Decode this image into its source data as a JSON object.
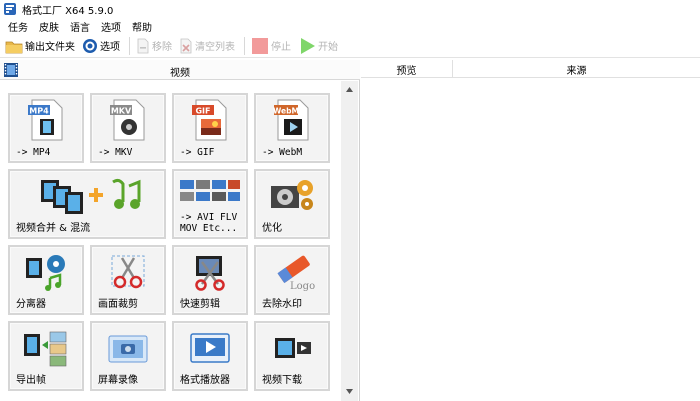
{
  "window": {
    "title": "格式工厂 X64 5.9.0"
  },
  "menu": {
    "items": [
      "任务",
      "皮肤",
      "语言",
      "选项",
      "帮助"
    ]
  },
  "toolbar": {
    "output_folder": "输出文件夹",
    "options": "选项",
    "remove": "移除",
    "clear_list": "清空列表",
    "stop": "停止",
    "start": "开始"
  },
  "category": {
    "title": "视频"
  },
  "tiles": [
    {
      "id": "mp4",
      "label": "-> MP4",
      "badge": "MP4"
    },
    {
      "id": "mkv",
      "label": "-> MKV",
      "badge": "MKV"
    },
    {
      "id": "gif",
      "label": "-> GIF",
      "badge": "GIF"
    },
    {
      "id": "webm",
      "label": "-> WebM",
      "badge": "WebM"
    },
    {
      "id": "merge",
      "label": "视频合并 & 混流"
    },
    {
      "id": "avi",
      "label": "-> AVI FLV\nMOV Etc..."
    },
    {
      "id": "optimize",
      "label": "优化"
    },
    {
      "id": "splitter",
      "label": "分离器"
    },
    {
      "id": "crop",
      "label": "画面裁剪"
    },
    {
      "id": "quickcut",
      "label": "快速剪辑"
    },
    {
      "id": "watermark",
      "label": "去除水印",
      "logo_text": "Logo"
    },
    {
      "id": "frames",
      "label": "导出帧"
    },
    {
      "id": "record",
      "label": "屏幕录像"
    },
    {
      "id": "player",
      "label": "格式播放器"
    },
    {
      "id": "download",
      "label": "视频下载"
    }
  ],
  "list": {
    "col_preview": "预览",
    "col_source": "来源"
  },
  "colors": {
    "mp4_badge": "#3b79c9",
    "mkv_badge": "#8a8a8a",
    "gif_badge": "#d84a2a",
    "webm_badge": "#d0662a",
    "start": "#5dc64a",
    "stop": "#f08c8c"
  },
  "icons": {
    "app": "format-factory-icon",
    "output_folder": "folder-icon",
    "options": "gear-icon",
    "remove": "remove-document-icon",
    "clear": "clear-list-icon",
    "stop": "stop-icon",
    "start": "play-icon"
  }
}
